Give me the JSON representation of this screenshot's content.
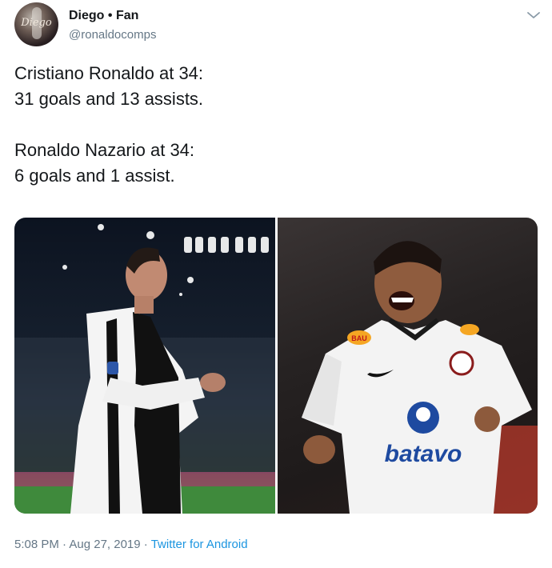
{
  "author": {
    "display_name": "Diego • Fan",
    "handle": "@ronaldocomps",
    "avatar_text": "Diego"
  },
  "tweet": {
    "lines": [
      "Cristiano Ronaldo at 34:",
      "31 goals and 13 assists.",
      "Ronaldo Nazario at 34:",
      "6 goals and 1 assist."
    ]
  },
  "media": {
    "left_sponsor_text": "",
    "right_sponsor_text": "batavo",
    "right_badge_text": "BAU"
  },
  "meta": {
    "timestamp": "5:08 PM · Aug 27, 2019 ·",
    "source": "Twitter for Android"
  },
  "colors": {
    "text": "#14171a",
    "secondary": "#657786",
    "link": "#1b95e0"
  },
  "icons": {
    "menu": "chevron-down-icon"
  }
}
